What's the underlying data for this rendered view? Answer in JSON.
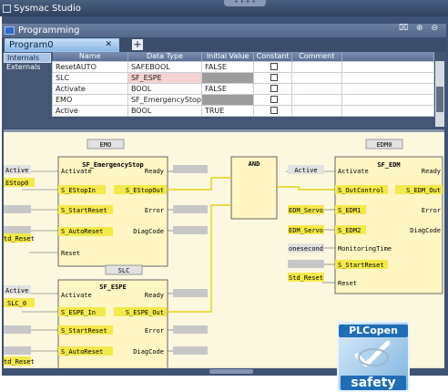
{
  "app": {
    "title": "Sysmac Studio"
  },
  "panel": {
    "title": "Programming",
    "controls": "⌧ ⊕ ⊖"
  },
  "tabs": [
    {
      "label": "Program0"
    }
  ],
  "side_tabs": [
    "Internals",
    "Externals"
  ],
  "variables": {
    "headers": [
      "Name",
      "Data Type",
      "Initial Value",
      "Constant",
      "Comment"
    ],
    "rows": [
      {
        "name": "ResetAUTO",
        "type": "SAFEBOOL",
        "initial": "FALSE"
      },
      {
        "name": "SLC",
        "type": "SF_ESPE",
        "initial": ""
      },
      {
        "name": "Activate",
        "type": "BOOL",
        "initial": "FALSE"
      },
      {
        "name": "EMO",
        "type": "SF_EmergencyStop",
        "initial": ""
      },
      {
        "name": "Active",
        "type": "BOOL",
        "initial": "TRUE"
      }
    ]
  },
  "diagram": {
    "blocks": [
      {
        "instance": "EMO",
        "type": "SF_EmergencyStop",
        "inputs": [
          "Activate",
          "S_EStopIn",
          "S_StartReset",
          "S_AutoReset",
          "Reset"
        ],
        "outputs": [
          "Ready",
          "S_EStopOut",
          "Error",
          "DiagCode"
        ]
      },
      {
        "instance": "SLC",
        "type": "SF_ESPE",
        "inputs": [
          "Activate",
          "S_ESPE_In",
          "S_StartReset",
          "S_AutoReset"
        ],
        "outputs": [
          "Ready",
          "S_ESPE_Out",
          "Error",
          "DiagCode"
        ]
      },
      {
        "instance": "",
        "type": "AND",
        "inputs": [],
        "outputs": []
      },
      {
        "instance": "EDM0",
        "type": "SF_EDM",
        "inputs": [
          "Activate",
          "S_OutControl",
          "S_EDM1",
          "S_EDM2",
          "MonitoringTime",
          "S_StartReset",
          "Reset"
        ],
        "outputs": [
          "Ready",
          "S_EDM_Out",
          "Error",
          "DiagCode"
        ]
      }
    ],
    "variables_left_emo": [
      "Active",
      "EStop0",
      "",
      "",
      "td_Reset"
    ],
    "variables_left_slc": [
      "Active",
      "SLC_0",
      "",
      "",
      "td_Reset"
    ],
    "variables_left_edm": [
      "Active",
      "",
      "EDM_Servo",
      "EDM_Servo",
      "onesecond",
      "",
      "Std_Reset"
    ]
  },
  "badge": {
    "brand": "PLCopen",
    "word": "safety"
  }
}
